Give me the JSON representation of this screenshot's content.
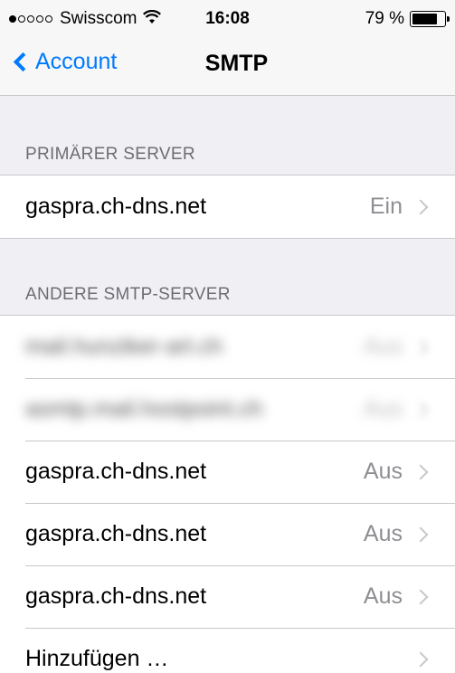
{
  "status_bar": {
    "signal_dots_filled": 1,
    "signal_dots_total": 5,
    "carrier": "Swisscom",
    "wifi_icon": "wifi-icon",
    "time": "16:08",
    "battery_percent": "79 %",
    "battery_level": 0.79
  },
  "navbar": {
    "back_label": "Account",
    "title": "SMTP"
  },
  "primary_section": {
    "header": "PRIMÄRER SERVER",
    "rows": [
      {
        "label": "gaspra.ch-dns.net",
        "value": "Ein"
      }
    ]
  },
  "other_section": {
    "header": "ANDERE SMTP-SERVER",
    "blurred_rows": [
      {
        "label": "mail.hunziker-art.ch",
        "value": "Aus"
      },
      {
        "label": "asmtp.mail.hostpoint.ch",
        "value": "Aus"
      }
    ],
    "rows": [
      {
        "label": "gaspra.ch-dns.net",
        "value": "Aus"
      },
      {
        "label": "gaspra.ch-dns.net",
        "value": "Aus"
      },
      {
        "label": "gaspra.ch-dns.net",
        "value": "Aus"
      }
    ],
    "add_label": "Hinzufügen …"
  }
}
